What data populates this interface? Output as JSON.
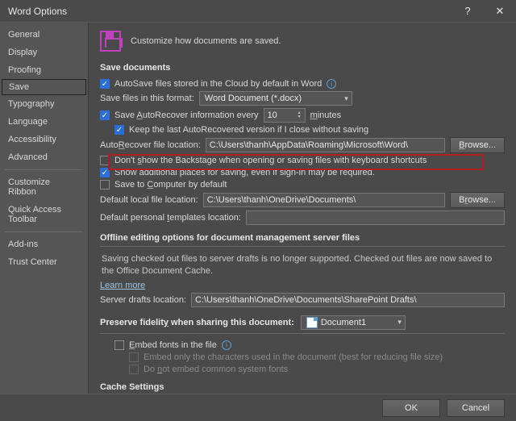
{
  "title": "Word Options",
  "header_subtitle": "Customize how documents are saved.",
  "sidebar": {
    "items": [
      "General",
      "Display",
      "Proofing",
      "Save",
      "Typography",
      "Language",
      "Accessibility",
      "Advanced",
      "Customize Ribbon",
      "Quick Access Toolbar",
      "Add-ins",
      "Trust Center"
    ],
    "separators_after": [
      7,
      9
    ],
    "selected_index": 3
  },
  "sections": {
    "save_documents": {
      "title": "Save documents",
      "autosave_cloud": "AutoSave files stored in the Cloud by default in Word",
      "save_format_label": "Save files in this format:",
      "save_format_value": "Word Document (*.docx)",
      "autorecover_label_pre": "Save AutoRecover information every",
      "autorecover_value": "10",
      "autorecover_label_post": "minutes",
      "keep_last": "Keep the last AutoRecovered version if I close without saving",
      "autorecover_loc_label": "AutoRecover file location:",
      "autorecover_loc_value": "C:\\Users\\thanh\\AppData\\Roaming\\Microsoft\\Word\\",
      "browse": "Browse...",
      "dont_show_backstage": "Don't show the Backstage when opening or saving files with keyboard shortcuts",
      "show_additional": "Show additional places for saving, even if sign-in may be required.",
      "save_to_computer": "Save to Computer by default",
      "default_local_label": "Default local file location:",
      "default_local_value": "C:\\Users\\thanh\\OneDrive\\Documents\\",
      "default_templates_label": "Default personal templates location:",
      "default_templates_value": ""
    },
    "offline": {
      "title": "Offline editing options for document management server files",
      "note": "Saving checked out files to server drafts is no longer supported. Checked out files are now saved to the Office Document Cache.",
      "learn_more": "Learn more",
      "server_drafts_label": "Server drafts location:",
      "server_drafts_value": "C:\\Users\\thanh\\OneDrive\\Documents\\SharePoint Drafts\\"
    },
    "preserve": {
      "title_pre": "Preserve fidelity when sharing this document:",
      "doc_value": "Document1",
      "embed_fonts": "Embed fonts in the file",
      "embed_only": "Embed only the characters used in the document (best for reducing file size)",
      "do_not_embed": "Do not embed common system fonts"
    },
    "cache": {
      "title": "Cache Settings"
    }
  },
  "footer": {
    "ok": "OK",
    "cancel": "Cancel"
  }
}
